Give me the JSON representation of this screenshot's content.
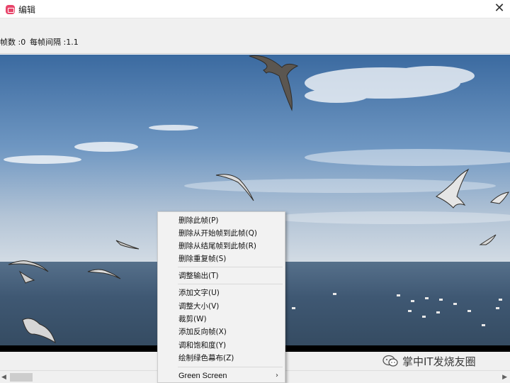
{
  "window": {
    "title": "编辑",
    "close_symbol": "✕"
  },
  "info": {
    "frame_count": "帧数 :0",
    "frame_interval": "每帧间隔 :1.1"
  },
  "context_menu": {
    "items": [
      {
        "label": "删除此帧(P)"
      },
      {
        "label": "删除从开始帧到此帧(Q)"
      },
      {
        "label": "删除从结尾帧到此帧(R)"
      },
      {
        "label": "删除重复帧(S)"
      },
      {
        "label": "调整输出(T)"
      },
      {
        "label": "添加文字(U)"
      },
      {
        "label": "调整大小(V)"
      },
      {
        "label": "裁剪(W)"
      },
      {
        "label": "添加反向帧(X)"
      },
      {
        "label": "调和饱和度(Y)"
      },
      {
        "label": "绘制绿色幕布(Z)"
      },
      {
        "label": "Green Screen",
        "submenu_arrow": "›"
      }
    ]
  },
  "watermark": {
    "text": "掌中IT发烧友圈"
  },
  "scrollbar": {
    "left_arrow": "◀",
    "right_arrow": "▶"
  },
  "colors": {
    "accent_icon": "#e8456a",
    "sky_top": "#3d6da3",
    "sky_bottom": "#c6d2df",
    "sea": "#3e566e"
  }
}
